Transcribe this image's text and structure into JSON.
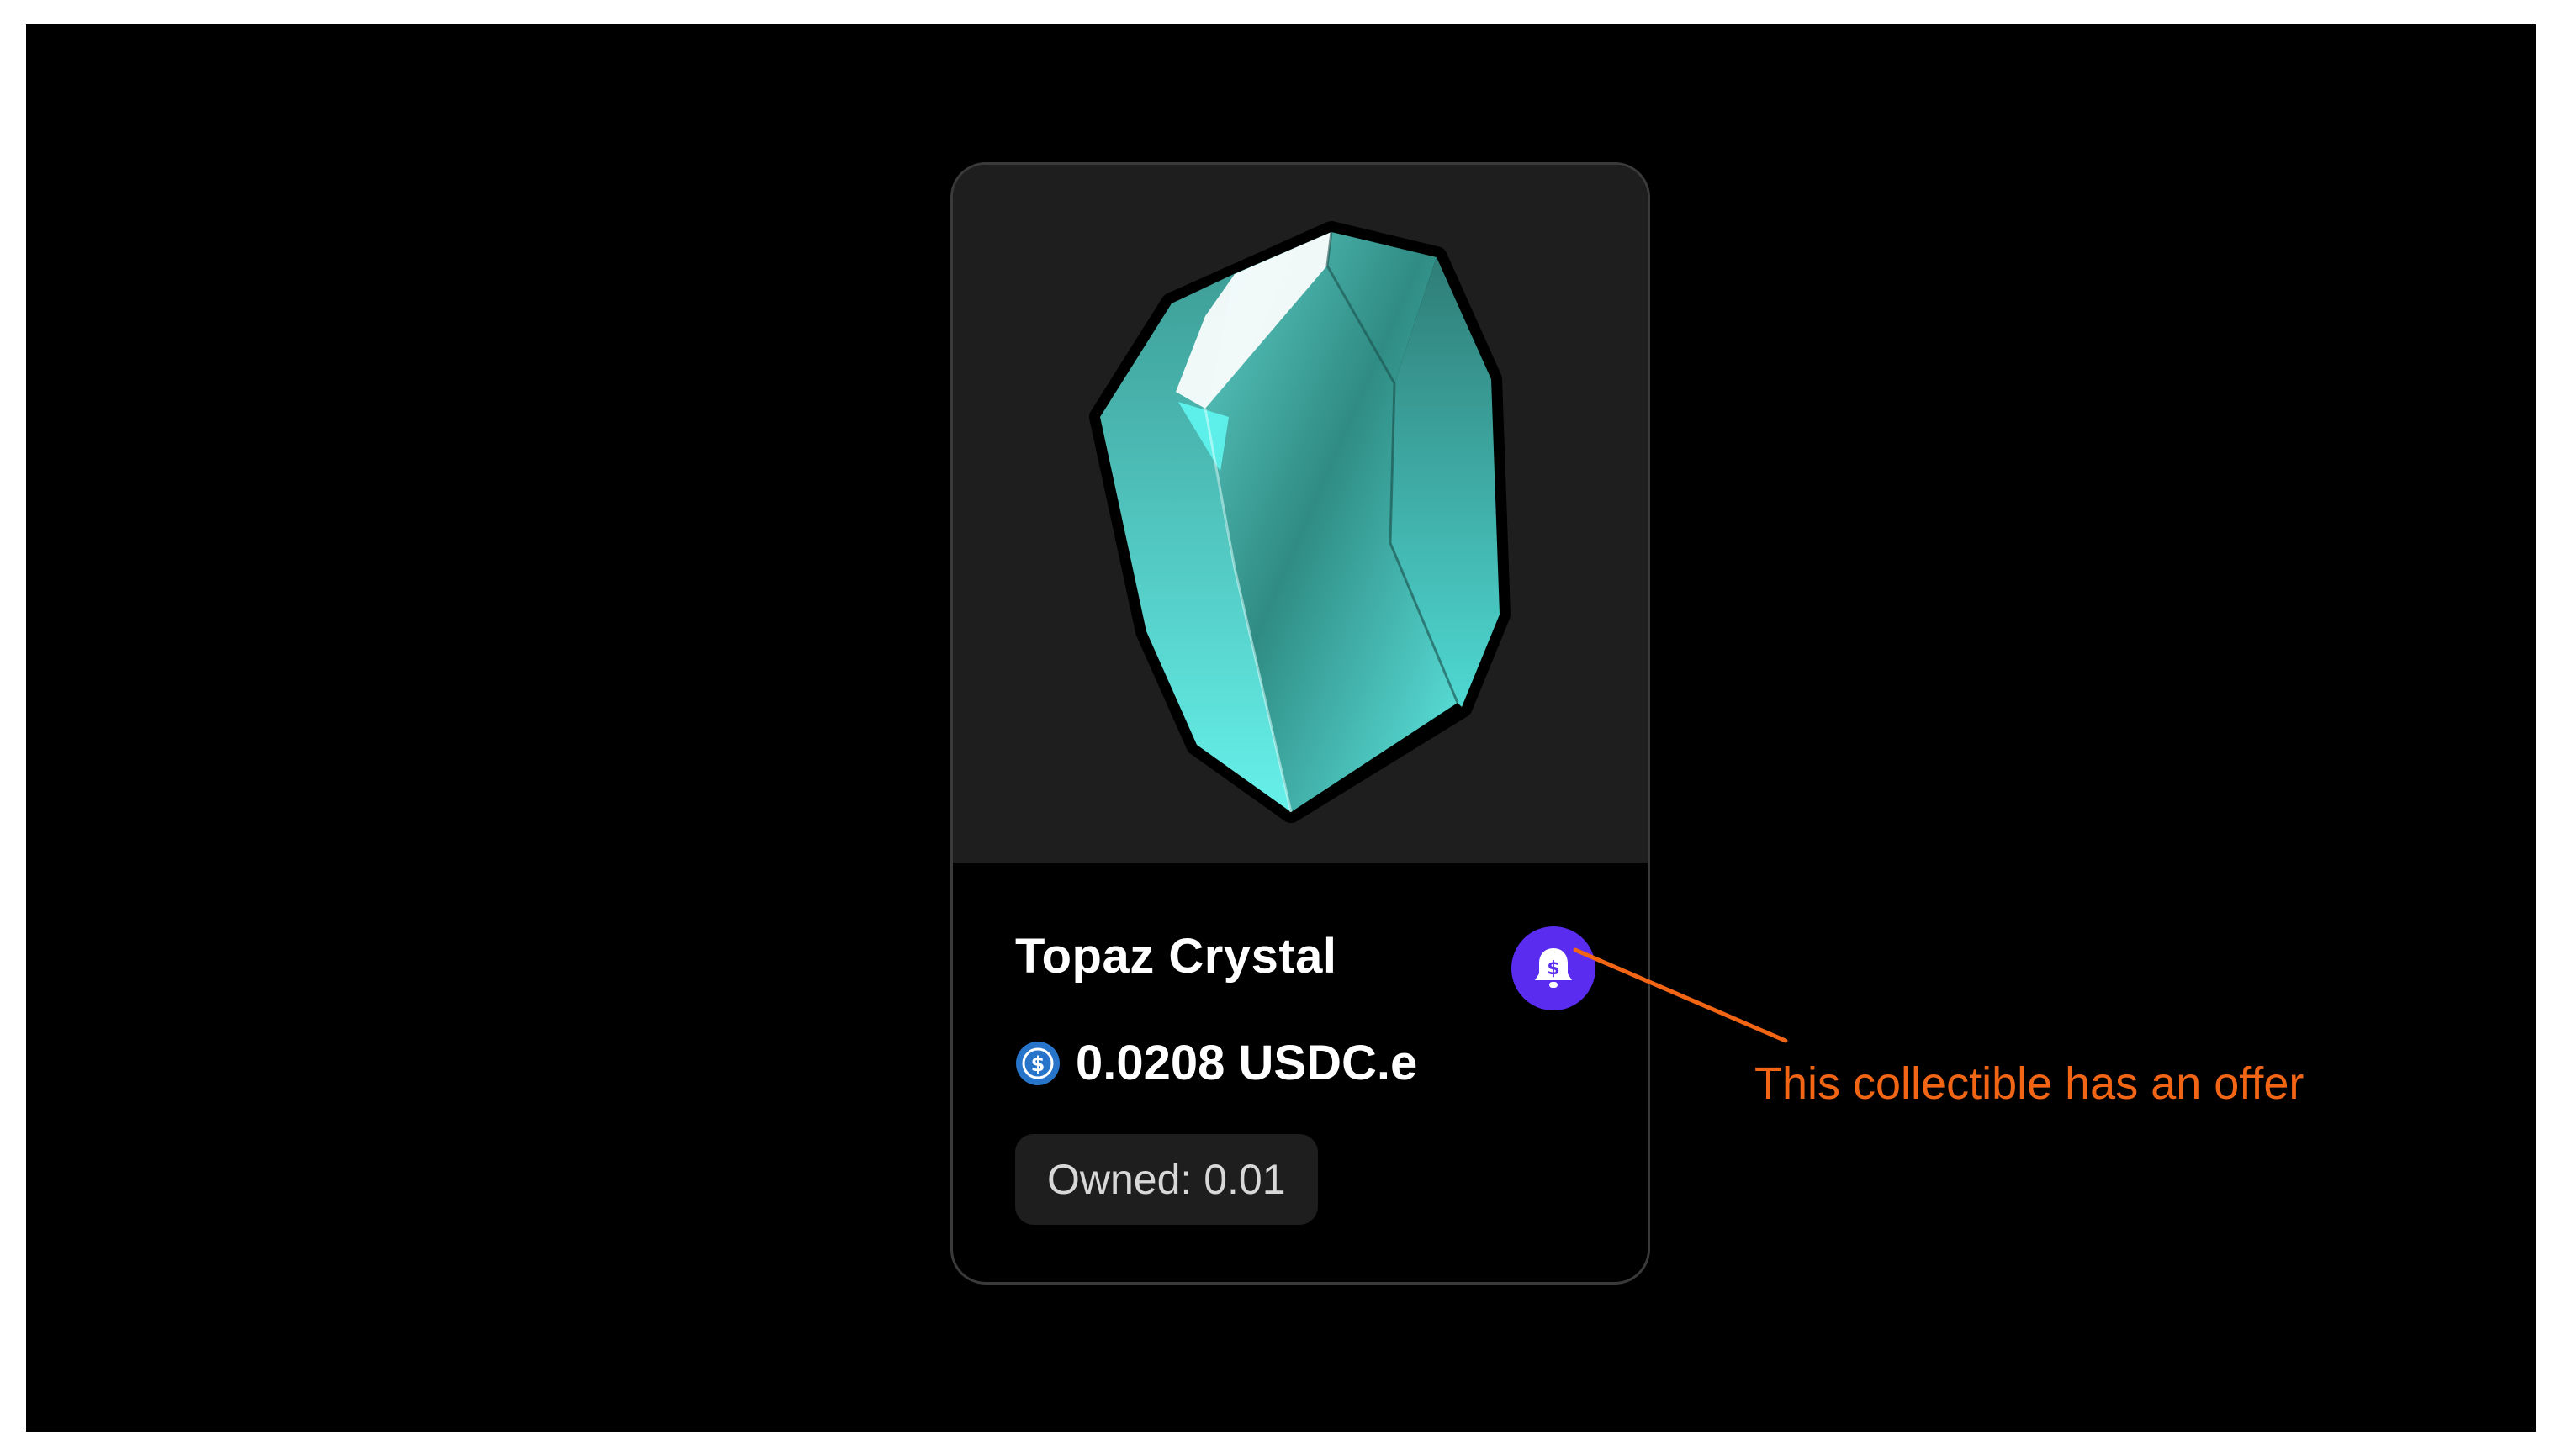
{
  "card": {
    "title": "Topaz Crystal",
    "price": "0.0208 USDC.e",
    "price_token_icon": "usdc-coin-icon",
    "owned": "Owned: 0.01",
    "offer_badge_icon": "bell-dollar-icon",
    "image": "topaz-crystal-gem"
  },
  "annotation": {
    "text": "This collectible has an offer"
  },
  "colors": {
    "background": "#000000",
    "frame": "#ffffff",
    "card_media_bg": "#1e1e1e",
    "card_border": "#3a3a3a",
    "badge": "#5a2cf0",
    "annotation": "#f26514",
    "gem_cyan": "#4fe0dc",
    "token_blue": "#2775ca"
  }
}
